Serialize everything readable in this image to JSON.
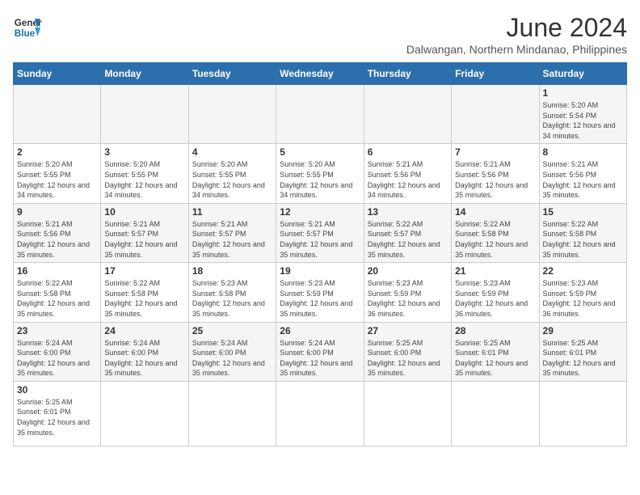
{
  "header": {
    "logo_general": "General",
    "logo_blue": "Blue",
    "month_title": "June 2024",
    "subtitle": "Dalwangan, Northern Mindanao, Philippines"
  },
  "days_of_week": [
    "Sunday",
    "Monday",
    "Tuesday",
    "Wednesday",
    "Thursday",
    "Friday",
    "Saturday"
  ],
  "weeks": [
    [
      {
        "day": "",
        "info": ""
      },
      {
        "day": "",
        "info": ""
      },
      {
        "day": "",
        "info": ""
      },
      {
        "day": "",
        "info": ""
      },
      {
        "day": "",
        "info": ""
      },
      {
        "day": "",
        "info": ""
      },
      {
        "day": "1",
        "info": "Sunrise: 5:20 AM\nSunset: 5:54 PM\nDaylight: 12 hours and 34 minutes."
      }
    ],
    [
      {
        "day": "2",
        "info": "Sunrise: 5:20 AM\nSunset: 5:55 PM\nDaylight: 12 hours and 34 minutes."
      },
      {
        "day": "3",
        "info": "Sunrise: 5:20 AM\nSunset: 5:55 PM\nDaylight: 12 hours and 34 minutes."
      },
      {
        "day": "4",
        "info": "Sunrise: 5:20 AM\nSunset: 5:55 PM\nDaylight: 12 hours and 34 minutes."
      },
      {
        "day": "5",
        "info": "Sunrise: 5:20 AM\nSunset: 5:55 PM\nDaylight: 12 hours and 34 minutes."
      },
      {
        "day": "6",
        "info": "Sunrise: 5:21 AM\nSunset: 5:56 PM\nDaylight: 12 hours and 34 minutes."
      },
      {
        "day": "7",
        "info": "Sunrise: 5:21 AM\nSunset: 5:56 PM\nDaylight: 12 hours and 35 minutes."
      },
      {
        "day": "8",
        "info": "Sunrise: 5:21 AM\nSunset: 5:56 PM\nDaylight: 12 hours and 35 minutes."
      }
    ],
    [
      {
        "day": "9",
        "info": "Sunrise: 5:21 AM\nSunset: 5:56 PM\nDaylight: 12 hours and 35 minutes."
      },
      {
        "day": "10",
        "info": "Sunrise: 5:21 AM\nSunset: 5:57 PM\nDaylight: 12 hours and 35 minutes."
      },
      {
        "day": "11",
        "info": "Sunrise: 5:21 AM\nSunset: 5:57 PM\nDaylight: 12 hours and 35 minutes."
      },
      {
        "day": "12",
        "info": "Sunrise: 5:21 AM\nSunset: 5:57 PM\nDaylight: 12 hours and 35 minutes."
      },
      {
        "day": "13",
        "info": "Sunrise: 5:22 AM\nSunset: 5:57 PM\nDaylight: 12 hours and 35 minutes."
      },
      {
        "day": "14",
        "info": "Sunrise: 5:22 AM\nSunset: 5:58 PM\nDaylight: 12 hours and 35 minutes."
      },
      {
        "day": "15",
        "info": "Sunrise: 5:22 AM\nSunset: 5:58 PM\nDaylight: 12 hours and 35 minutes."
      }
    ],
    [
      {
        "day": "16",
        "info": "Sunrise: 5:22 AM\nSunset: 5:58 PM\nDaylight: 12 hours and 35 minutes."
      },
      {
        "day": "17",
        "info": "Sunrise: 5:22 AM\nSunset: 5:58 PM\nDaylight: 12 hours and 35 minutes."
      },
      {
        "day": "18",
        "info": "Sunrise: 5:23 AM\nSunset: 5:58 PM\nDaylight: 12 hours and 35 minutes."
      },
      {
        "day": "19",
        "info": "Sunrise: 5:23 AM\nSunset: 5:59 PM\nDaylight: 12 hours and 35 minutes."
      },
      {
        "day": "20",
        "info": "Sunrise: 5:23 AM\nSunset: 5:59 PM\nDaylight: 12 hours and 36 minutes."
      },
      {
        "day": "21",
        "info": "Sunrise: 5:23 AM\nSunset: 5:59 PM\nDaylight: 12 hours and 36 minutes."
      },
      {
        "day": "22",
        "info": "Sunrise: 5:23 AM\nSunset: 5:59 PM\nDaylight: 12 hours and 36 minutes."
      }
    ],
    [
      {
        "day": "23",
        "info": "Sunrise: 5:24 AM\nSunset: 6:00 PM\nDaylight: 12 hours and 35 minutes."
      },
      {
        "day": "24",
        "info": "Sunrise: 5:24 AM\nSunset: 6:00 PM\nDaylight: 12 hours and 35 minutes."
      },
      {
        "day": "25",
        "info": "Sunrise: 5:24 AM\nSunset: 6:00 PM\nDaylight: 12 hours and 35 minutes."
      },
      {
        "day": "26",
        "info": "Sunrise: 5:24 AM\nSunset: 6:00 PM\nDaylight: 12 hours and 35 minutes."
      },
      {
        "day": "27",
        "info": "Sunrise: 5:25 AM\nSunset: 6:00 PM\nDaylight: 12 hours and 35 minutes."
      },
      {
        "day": "28",
        "info": "Sunrise: 5:25 AM\nSunset: 6:01 PM\nDaylight: 12 hours and 35 minutes."
      },
      {
        "day": "29",
        "info": "Sunrise: 5:25 AM\nSunset: 6:01 PM\nDaylight: 12 hours and 35 minutes."
      }
    ],
    [
      {
        "day": "30",
        "info": "Sunrise: 5:25 AM\nSunset: 6:01 PM\nDaylight: 12 hours and 35 minutes."
      },
      {
        "day": "",
        "info": ""
      },
      {
        "day": "",
        "info": ""
      },
      {
        "day": "",
        "info": ""
      },
      {
        "day": "",
        "info": ""
      },
      {
        "day": "",
        "info": ""
      },
      {
        "day": "",
        "info": ""
      }
    ]
  ]
}
